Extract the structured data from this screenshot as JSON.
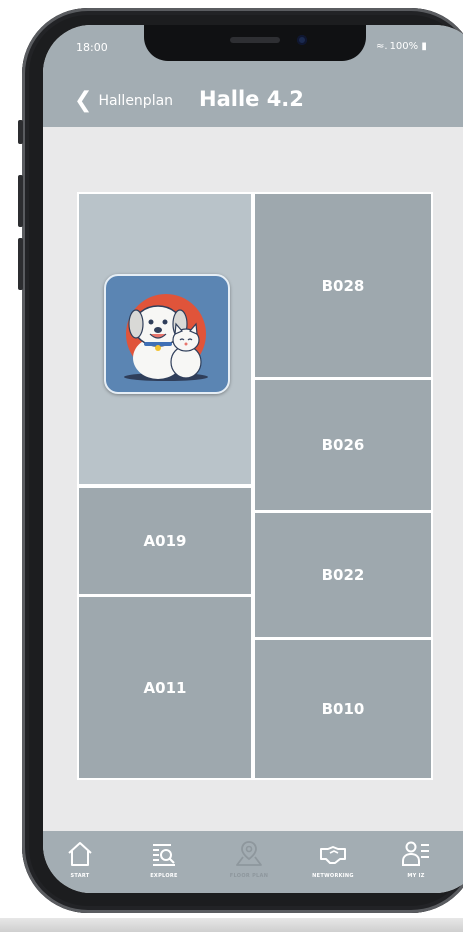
{
  "status": {
    "time": "18:00",
    "battery": "100%"
  },
  "header": {
    "back_label": "Hallenplan",
    "title": "Halle 4.2"
  },
  "floor_plan": {
    "booths": [
      {
        "id": "sponsor",
        "label": ""
      },
      {
        "id": "A019",
        "label": "A019"
      },
      {
        "id": "A011",
        "label": "A011"
      },
      {
        "id": "B028",
        "label": "B028"
      },
      {
        "id": "B026",
        "label": "B026"
      },
      {
        "id": "B022",
        "label": "B022"
      },
      {
        "id": "B010",
        "label": "B010"
      }
    ]
  },
  "tabbar": {
    "items": [
      {
        "label": "START",
        "icon": "home-icon"
      },
      {
        "label": "EXPLORE",
        "icon": "explore-search-icon"
      },
      {
        "label": "FLOOR PLAN",
        "icon": "map-pin-icon"
      },
      {
        "label": "NETWORKING",
        "icon": "handshake-icon"
      },
      {
        "label": "MY IZ",
        "icon": "profile-list-icon"
      }
    ]
  },
  "colors": {
    "header": "#a3adb3",
    "booth": "#9ea8ae",
    "sponsor_booth": "#b9c3c9",
    "background": "#e9e9ea"
  }
}
